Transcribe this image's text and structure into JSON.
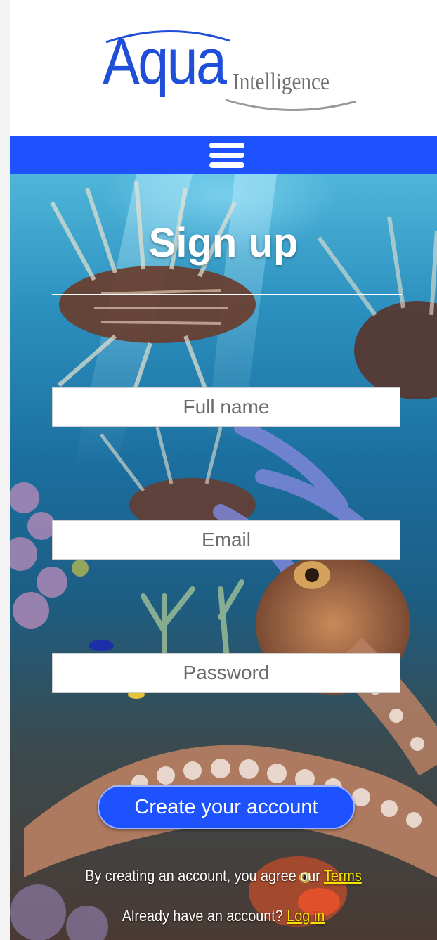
{
  "brand": {
    "logo_main": "Aqua",
    "logo_sub": "Intelligence",
    "primary_color": "#1f52ff",
    "logo_color": "#1f4fd8"
  },
  "nav": {
    "menu_icon": "hamburger-menu-icon"
  },
  "form": {
    "title": "Sign up",
    "fields": {
      "full_name": {
        "placeholder": "Full name",
        "value": ""
      },
      "email": {
        "placeholder": "Email",
        "value": ""
      },
      "password": {
        "placeholder": "Password",
        "value": ""
      }
    },
    "submit_label": "Create your account"
  },
  "footer": {
    "terms_prefix": "By creating an account, you agree our ",
    "terms_link": "Terms",
    "login_prefix": "Already have an account? ",
    "login_link": "Log in",
    "link_color": "#f2e600"
  }
}
